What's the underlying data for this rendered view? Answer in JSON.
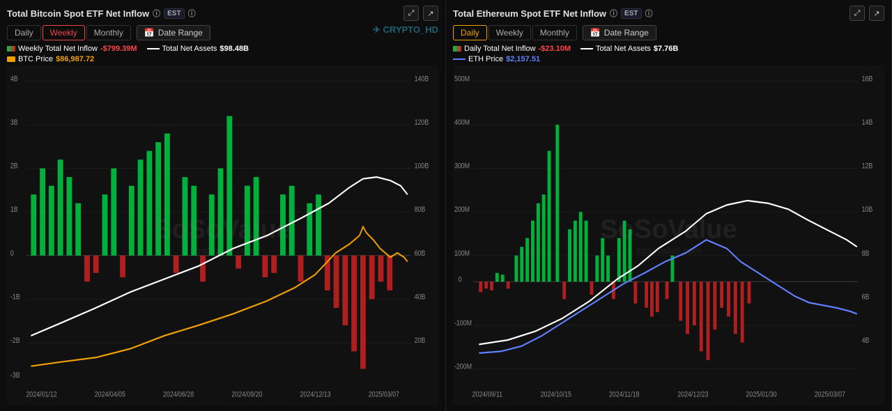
{
  "btc_panel": {
    "title": "Total Bitcoin Spot ETF Net Inflow",
    "est": "EST",
    "tabs": [
      "Daily",
      "Weekly",
      "Monthly"
    ],
    "active_tab": "Weekly",
    "date_range_label": "Date Range",
    "legend": {
      "net_inflow_label": "Weekly Total Net Inflow",
      "net_inflow_value": "-$799.39M",
      "net_assets_label": "Total Net Assets",
      "net_assets_value": "$98.48B",
      "price_label": "BTC Price",
      "price_value": "$86,987.72"
    },
    "x_labels": [
      "2024/01/12",
      "2024/04/05",
      "2024/06/28",
      "2024/09/20",
      "2024/12/13",
      "2025/03/07"
    ],
    "y_left_labels": [
      "4B",
      "3B",
      "2B",
      "1B",
      "0",
      "-1B",
      "-2B",
      "-3B"
    ],
    "y_right_labels": [
      "140B",
      "120B",
      "100B",
      "80B",
      "60B",
      "40B",
      "20B"
    ],
    "watermark": "SoSoValue",
    "watermark_url": "sosovalue.com"
  },
  "eth_panel": {
    "title": "Total Ethereum Spot ETF Net Inflow",
    "est": "EST",
    "tabs": [
      "Daily",
      "Weekly",
      "Monthly"
    ],
    "active_tab": "Daily",
    "date_range_label": "Date Range",
    "legend": {
      "net_inflow_label": "Daily Total Net Inflow",
      "net_inflow_value": "-$23.10M",
      "net_assets_label": "Total Net Assets",
      "net_assets_value": "$7.76B",
      "price_label": "ETH Price",
      "price_value": "$2,157.51"
    },
    "x_labels": [
      "2024/09/11",
      "2024/10/15",
      "2024/11/18",
      "2024/12/23",
      "2025/01/30",
      "2025/03/07"
    ],
    "y_left_labels": [
      "500M",
      "400M",
      "300M",
      "200M",
      "100M",
      "0",
      "-100M",
      "-200M"
    ],
    "y_right_labels": [
      "16B",
      "14B",
      "12B",
      "10B",
      "8B",
      "6B",
      "4B"
    ],
    "watermark": "SoSoValue",
    "watermark_url": "sosovalue.com"
  },
  "icons": {
    "expand": "⤢",
    "share": "↗",
    "calendar": "📅",
    "info": "ⓘ"
  }
}
